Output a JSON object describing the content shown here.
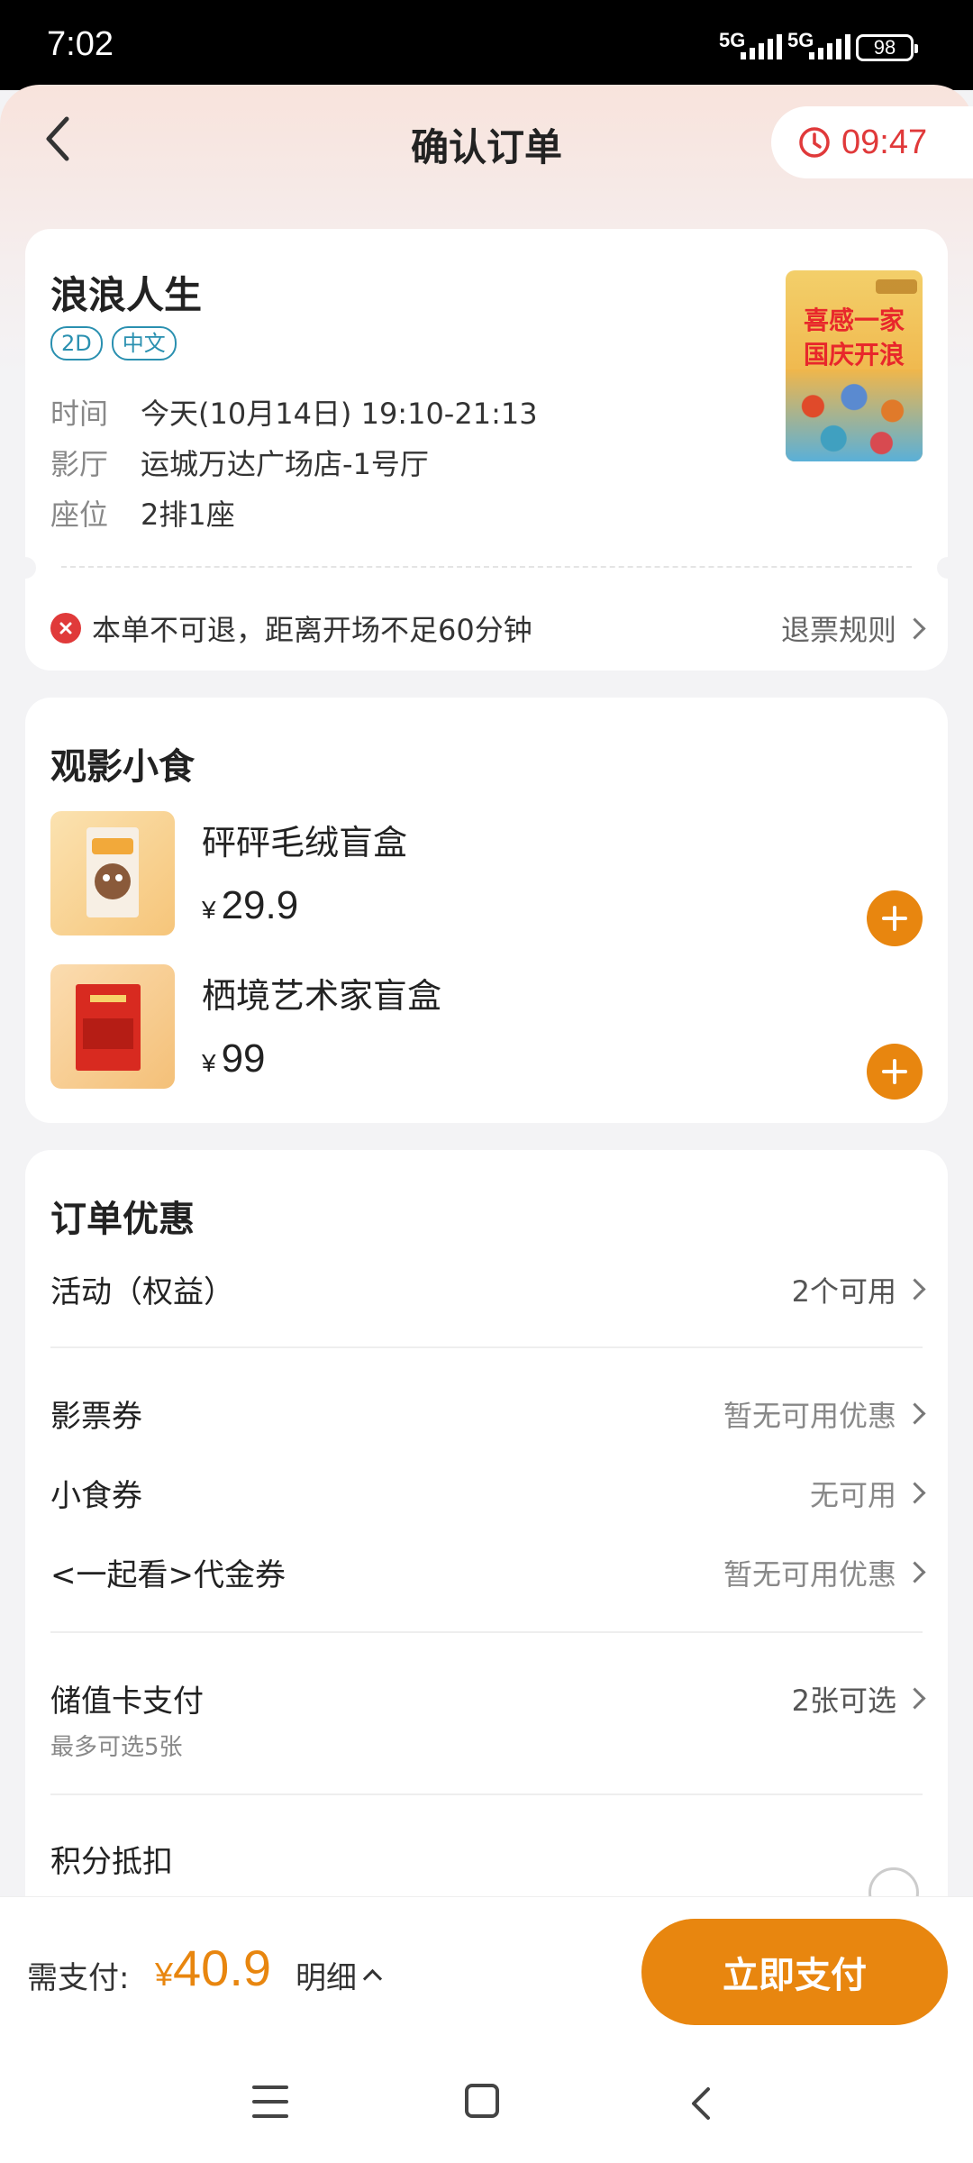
{
  "status_bar": {
    "time": "7:02",
    "network1": "5G",
    "network2": "5G",
    "battery": "98"
  },
  "header": {
    "title": "确认订单",
    "timer": "09:47"
  },
  "movie": {
    "name": "浪浪人生",
    "tags": [
      "2D",
      "中文"
    ],
    "info": [
      {
        "key": "时间",
        "value": "今天(10月14日) 19:10-21:13"
      },
      {
        "key": "影厅",
        "value": "运城万达广场店-1号厅"
      },
      {
        "key": "座位",
        "value": "2排1座"
      }
    ],
    "poster_text": [
      "喜感一家",
      "国庆开浪"
    ],
    "notice": "本单不可退，距离开场不足60分钟",
    "refund_rule": "退票规则"
  },
  "snacks": {
    "title": "观影小食",
    "items": [
      {
        "name": "砰砰毛绒盲盒",
        "currency": "¥",
        "price": "29.9"
      },
      {
        "name": "栖境艺术家盲盒",
        "currency": "¥",
        "price": "99"
      }
    ]
  },
  "promo": {
    "title": "订单优惠",
    "activity": {
      "label": "活动（权益）",
      "value": "2个可用"
    },
    "ticket_coupon": {
      "label": "影票券",
      "value": "暂无可用优惠"
    },
    "snack_coupon": {
      "label": "小食券",
      "value": "无可用"
    },
    "voucher": {
      "label": "<一起看>代金券",
      "value": "暂无可用优惠"
    },
    "stored_card": {
      "label": "储值卡支付",
      "sub": "最多可选5张",
      "value": "2张可选"
    },
    "points": {
      "label": "积分抵扣"
    }
  },
  "pay": {
    "need_label": "需支付:",
    "currency": "¥",
    "amount": "40.9",
    "detail": "明细",
    "button": "立即支付"
  },
  "colors": {
    "accent": "#e8860f",
    "timer": "#e0393a",
    "tag": "#2a90b0"
  }
}
